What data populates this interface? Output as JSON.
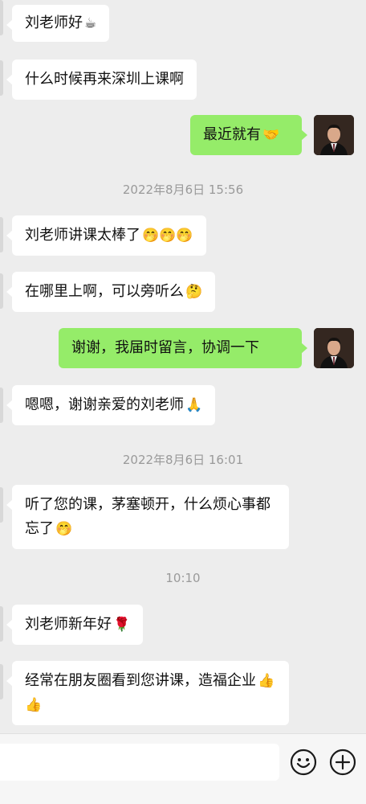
{
  "messages": [
    {
      "side": "left",
      "text": "刘老师好",
      "emoji": "☕"
    },
    {
      "side": "left",
      "text": "什么时候再来深圳上课啊",
      "emoji": ""
    },
    {
      "side": "right",
      "text": "最近就有",
      "emoji": "🤝"
    },
    {
      "timestamp": "2022年8月6日 15:56"
    },
    {
      "side": "left",
      "text": "刘老师讲课太棒了",
      "emoji": "🤭🤭🤭"
    },
    {
      "side": "left",
      "text": "在哪里上啊，可以旁听么",
      "emoji": "🤔"
    },
    {
      "side": "right",
      "text": "谢谢，我届时留言，协调一下",
      "emoji": ""
    },
    {
      "side": "left",
      "text": "嗯嗯，谢谢亲爱的刘老师",
      "emoji": "🙏"
    },
    {
      "timestamp": "2022年8月6日 16:01"
    },
    {
      "side": "left",
      "text": "听了您的课，茅塞顿开，什么烦心事都忘了",
      "emoji": "🤭"
    },
    {
      "timestamp": "10:10"
    },
    {
      "side": "left",
      "text": "刘老师新年好",
      "emoji": "🌹"
    },
    {
      "side": "left",
      "text": "经常在朋友圈看到您讲课，造福企业",
      "emoji": "👍👍"
    }
  ],
  "input": {
    "placeholder": ""
  },
  "icons": {
    "emoji_button": "smiley-face-icon",
    "more_button": "plus-circle-icon"
  },
  "colors": {
    "outgoing_bubble": "#95ec69",
    "incoming_bubble": "#ffffff",
    "background": "#ededed"
  }
}
